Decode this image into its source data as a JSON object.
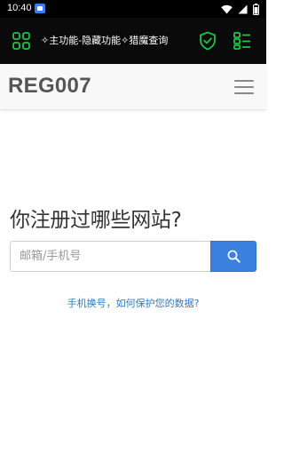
{
  "status_bar": {
    "time": "10:40",
    "icons": [
      "app-notification-icon",
      "wifi-icon",
      "signal-icon",
      "battery-icon"
    ]
  },
  "toolbar": {
    "title": "✧主功能-隐藏功能✧猎魔查询",
    "left_icon": "grid-icon",
    "right_icons": [
      "shield-check-icon",
      "list-icon"
    ],
    "accent_color": "#1ec24a"
  },
  "header": {
    "brand": "REG007",
    "menu_icon": "hamburger-menu-icon"
  },
  "main": {
    "headline": "你注册过哪些网站?",
    "search": {
      "placeholder": "邮箱/手机号",
      "value": "",
      "button_icon": "search-icon"
    },
    "help_link": "手机换号，如何保护您的数据?"
  },
  "colors": {
    "primary_button": "#3b82e0",
    "link": "#2f7bbf",
    "toolbar_bg": "#0a0a0a"
  }
}
